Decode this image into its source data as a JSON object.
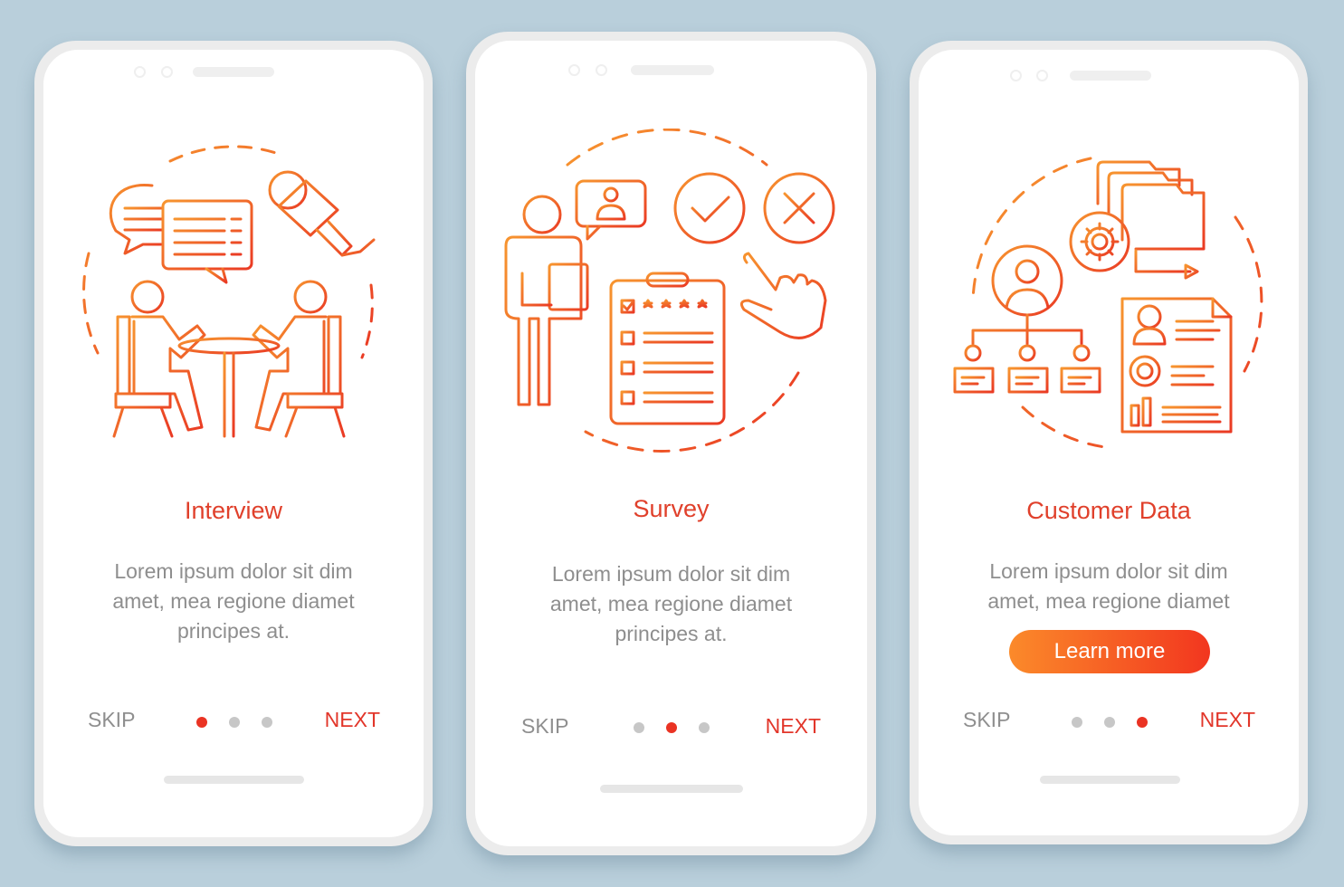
{
  "colors": {
    "background": "#b9cfdb",
    "accent": "#e2362a",
    "gradient_start": "#f7922e",
    "gradient_end": "#ea3a24",
    "text_muted": "#8e8e8e",
    "dot_inactive": "#c7c7c7"
  },
  "screens": [
    {
      "illustration": "interview-illustration",
      "title": "Interview",
      "body_lines": [
        "Lorem ipsum dolor sit dim",
        "amet, mea regione diamet",
        "principes at."
      ],
      "skip_label": "SKIP",
      "next_label": "NEXT",
      "page_index": 1,
      "page_count": 3
    },
    {
      "illustration": "survey-illustration",
      "title": "Survey",
      "body_lines": [
        "Lorem ipsum dolor sit dim",
        "amet, mea regione diamet",
        "principes at."
      ],
      "skip_label": "SKIP",
      "next_label": "NEXT",
      "page_index": 2,
      "page_count": 3
    },
    {
      "illustration": "customer-data-illustration",
      "title": "Customer Data",
      "body_lines": [
        "Lorem ipsum dolor sit dim",
        "amet, mea regione diamet"
      ],
      "button_label": "Learn more",
      "skip_label": "SKIP",
      "next_label": "NEXT",
      "page_index": 3,
      "page_count": 3
    }
  ]
}
